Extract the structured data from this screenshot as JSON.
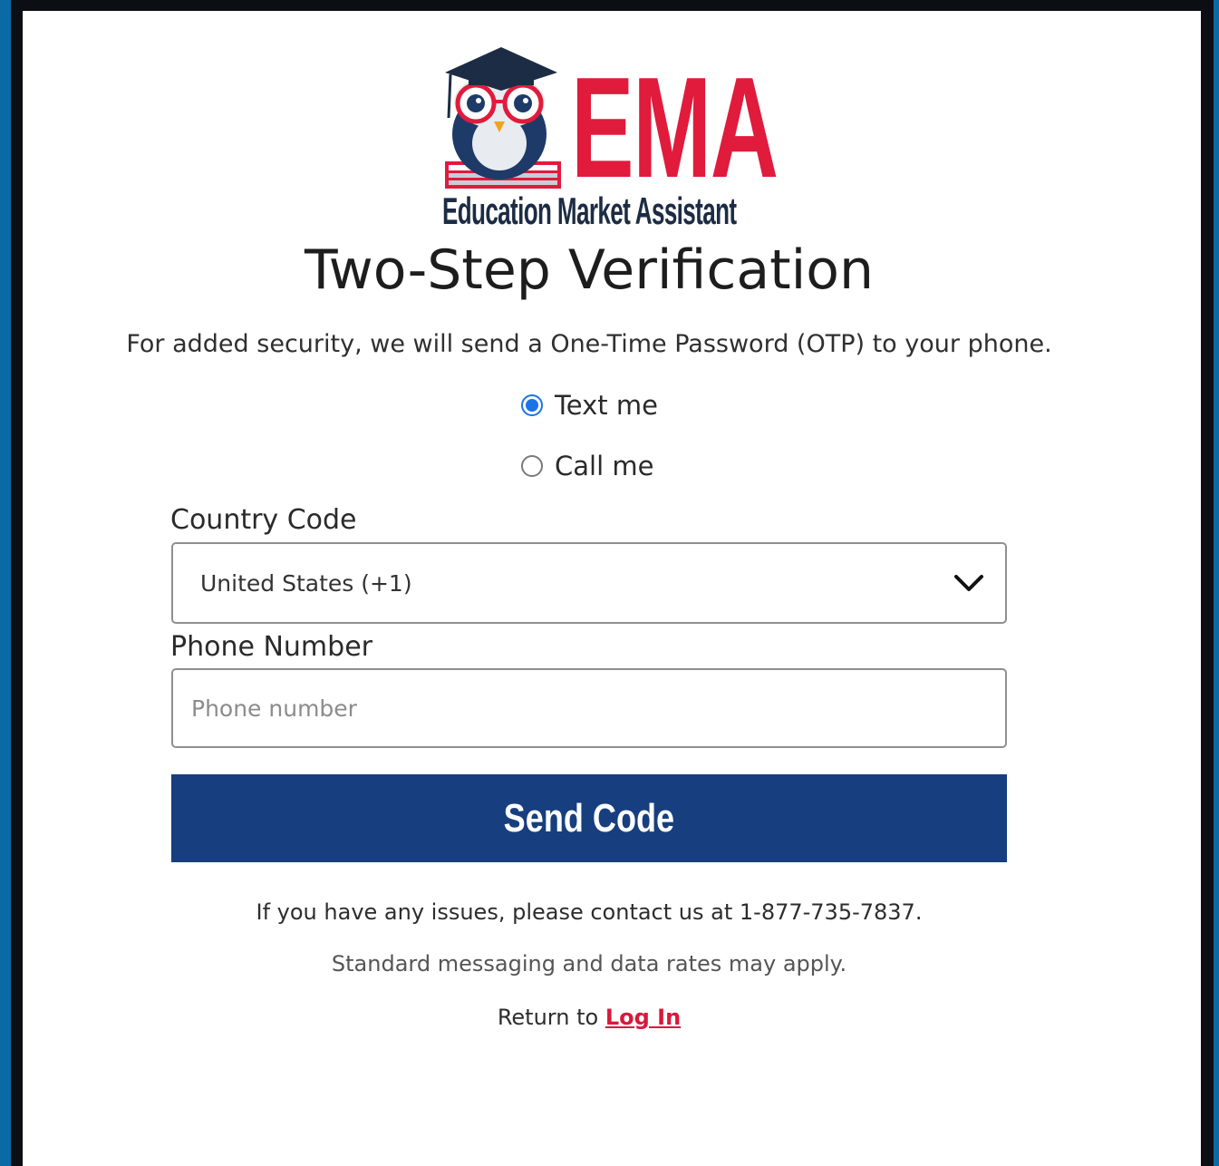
{
  "logo": {
    "wordmark": "EMA",
    "tagline": "Education Market Assistant"
  },
  "title": "Two-Step Verification",
  "subtitle": "For added security, we will send a One-Time Password (OTP) to your phone.",
  "delivery_options": [
    {
      "label": "Text me",
      "selected": true
    },
    {
      "label": "Call me",
      "selected": false
    }
  ],
  "country_code": {
    "label": "Country Code",
    "value": "United States (+1)"
  },
  "phone_number": {
    "label": "Phone Number",
    "placeholder": "Phone number",
    "value": ""
  },
  "send_button": "Send Code",
  "support_note": "If you have any issues, please contact us at 1-877-735-7837.",
  "rates_note": "Standard messaging and data rates may apply.",
  "return": {
    "prefix": "Return to",
    "link": "Log In"
  },
  "colors": {
    "brand_red": "#e01b3c",
    "button_blue": "#173f80",
    "radio_blue": "#1a73e8",
    "outer_blue": "#0a6aa6"
  }
}
